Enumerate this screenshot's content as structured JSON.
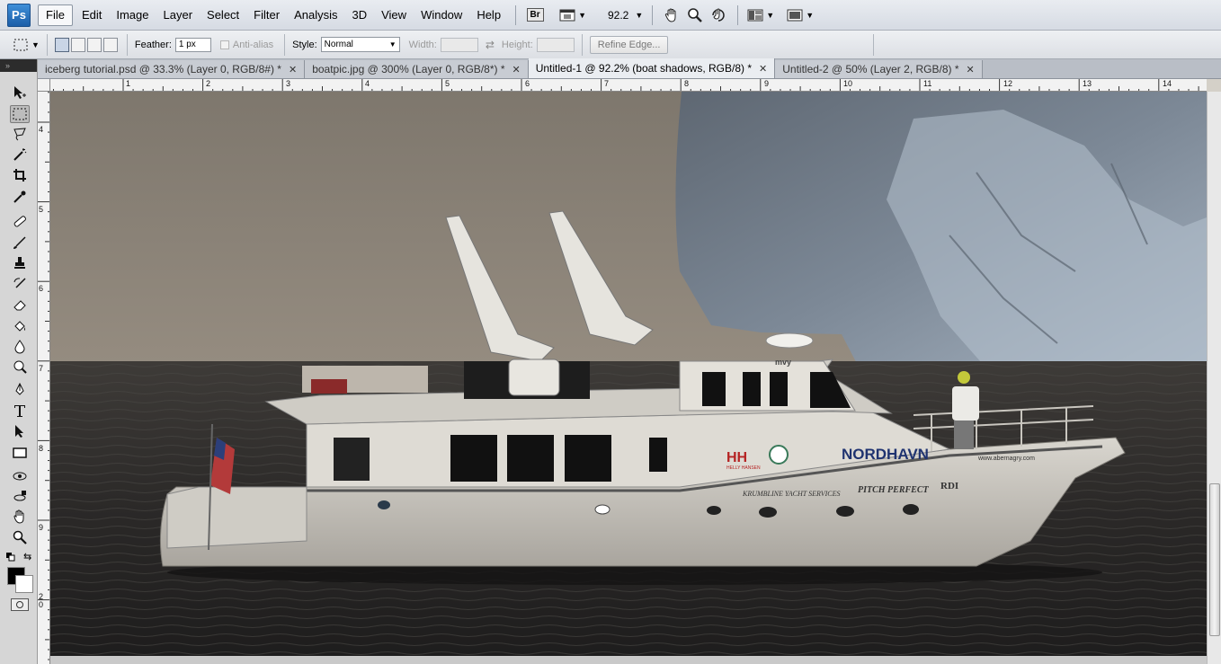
{
  "app": {
    "logo": "Ps"
  },
  "menu": [
    "File",
    "Edit",
    "Image",
    "Layer",
    "Select",
    "Filter",
    "Analysis",
    "3D",
    "View",
    "Window",
    "Help"
  ],
  "appbar": {
    "bridge_label": "Br",
    "zoom": "92.2",
    "icons": [
      "film-icon",
      "hand-icon",
      "zoom-icon",
      "rotate-icon",
      "arrange-icon",
      "screen-mode-icon"
    ]
  },
  "options": {
    "feather_label": "Feather:",
    "feather_value": "1 px",
    "antialias_label": "Anti-alias",
    "style_label": "Style:",
    "style_value": "Normal",
    "width_label": "Width:",
    "height_label": "Height:",
    "refine_label": "Refine Edge..."
  },
  "tabs": [
    {
      "label": "iceberg tutorial.psd @ 33.3% (Layer 0, RGB/8#) *",
      "active": false
    },
    {
      "label": "boatpic.jpg @ 300% (Layer 0, RGB/8*) *",
      "active": false
    },
    {
      "label": "Untitled-1 @ 92.2% (boat shadows, RGB/8) *",
      "active": true
    },
    {
      "label": "Untitled-2 @ 50% (Layer 2, RGB/8) *",
      "active": false
    }
  ],
  "rulers": {
    "horizontal": [
      "1",
      "2",
      "3",
      "4",
      "5",
      "6",
      "7",
      "8",
      "9",
      "10",
      "11",
      "12",
      "13",
      "14"
    ],
    "vertical": [
      "4",
      "5",
      "6",
      "7",
      "8",
      "9",
      "2\n0"
    ]
  },
  "canvas": {
    "boat_text": {
      "brand": "NORDHAVN",
      "hh": "HH",
      "hh_sub": "HELLY HANSEN",
      "yacht_services": "KRUMBLINE YACHT SERVICES",
      "pitch": "PITCH PERFECT",
      "rdi": "RDI",
      "website": "www.abernagry.com",
      "bridge": "mvy"
    }
  },
  "colors": {
    "foreground": "#000000",
    "background": "#ffffff",
    "accent": "#1c5ea8"
  }
}
